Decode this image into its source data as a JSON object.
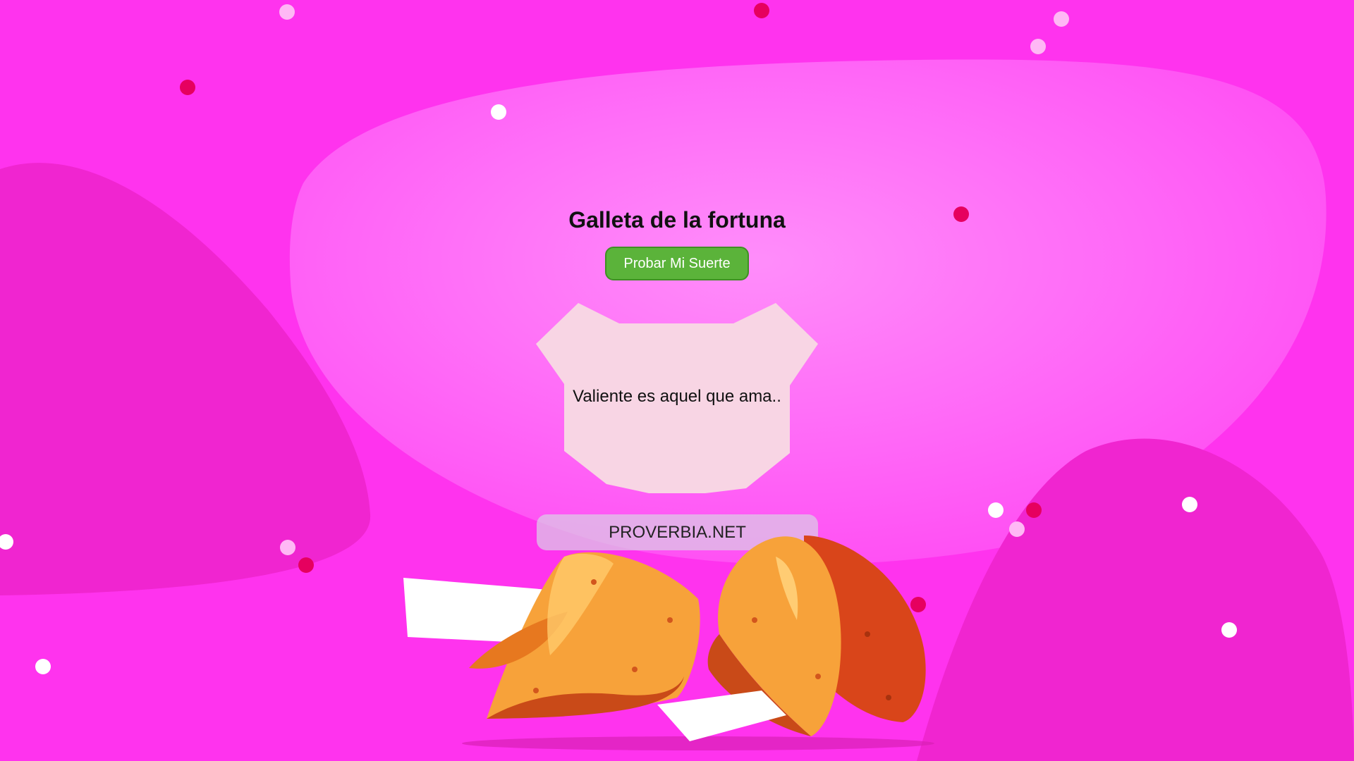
{
  "page": {
    "title": "Galleta de la fortuna",
    "button_label": "Probar Mi Suerte",
    "fortune_message": "Valiente es aquel que ama..",
    "brand": "PROVERBIA.NET"
  },
  "colors": {
    "background": "#ff33ee",
    "button": "#5bb33a",
    "paper": "#f8d5e4",
    "cookie": "#f7a23a"
  },
  "icons": [
    "fortune-cookie-illustration",
    "confetti-dots"
  ]
}
